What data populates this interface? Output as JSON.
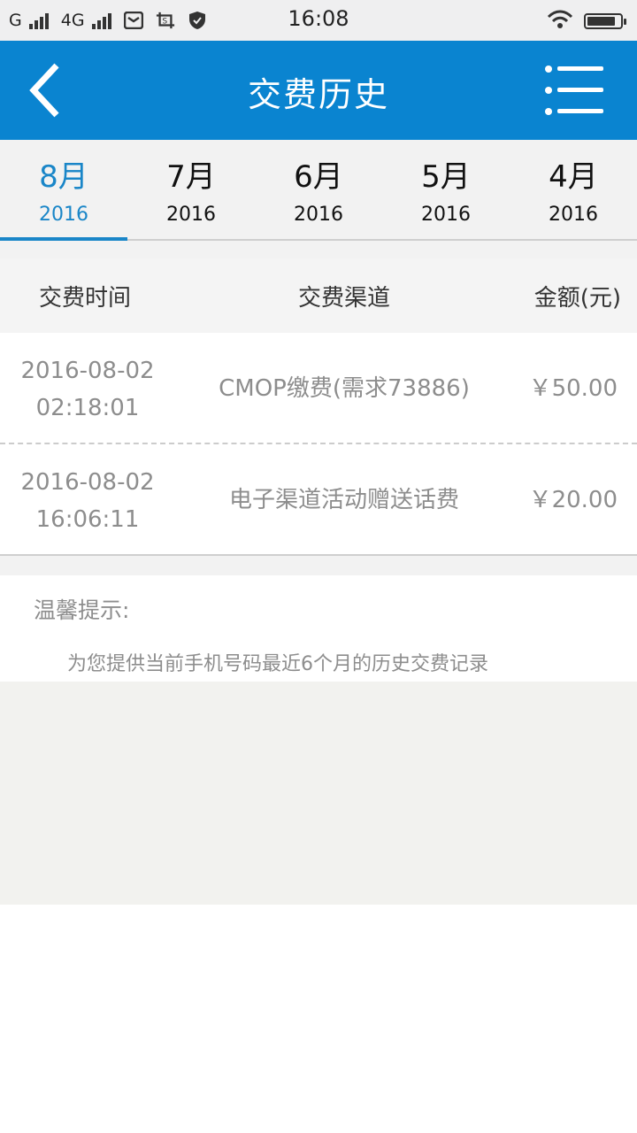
{
  "status_bar": {
    "network_1": "G",
    "network_2": "4G",
    "time": "16:08",
    "icons": [
      "mail-icon",
      "screenshot-icon",
      "shield-icon",
      "wifi-icon",
      "battery-icon"
    ],
    "battery_level": 0.85
  },
  "header": {
    "title": "交费历史",
    "background_color": "#0a84d0",
    "back_icon": "chevron-left-icon",
    "menu_icon": "list-menu-icon"
  },
  "tabs": [
    {
      "month": "8月",
      "year": "2016",
      "active": true
    },
    {
      "month": "7月",
      "year": "2016",
      "active": false
    },
    {
      "month": "6月",
      "year": "2016",
      "active": false
    },
    {
      "month": "5月",
      "year": "2016",
      "active": false
    },
    {
      "month": "4月",
      "year": "2016",
      "active": false
    }
  ],
  "accent_color": "#1a86c8",
  "table": {
    "headers": {
      "time": "交费时间",
      "channel": "交费渠道",
      "amount": "金额(元)"
    },
    "rows": [
      {
        "date": "2016-08-02",
        "time": "02:18:01",
        "channel": "CMOP缴费(需求73886)",
        "amount": "￥50.00"
      },
      {
        "date": "2016-08-02",
        "time": "16:06:11",
        "channel": "电子渠道活动赠送话费",
        "amount": "￥20.00"
      }
    ]
  },
  "tips": {
    "title": "温馨提示:",
    "text": "为您提供当前手机号码最近6个月的历史交费记录"
  }
}
